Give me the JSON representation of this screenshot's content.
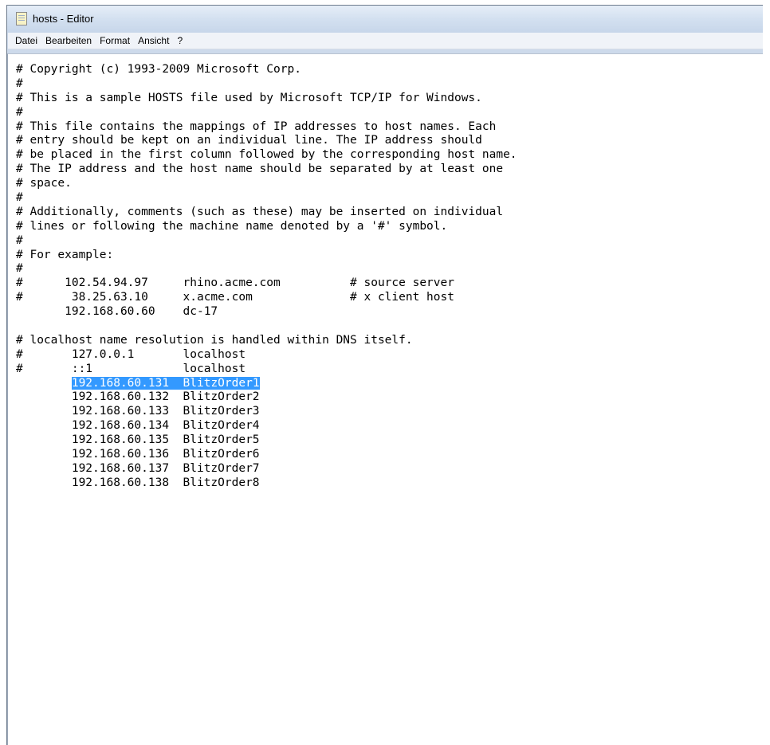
{
  "window": {
    "title": "hosts - Editor",
    "icon": "notepad-icon"
  },
  "menu": {
    "items": [
      "Datei",
      "Bearbeiten",
      "Format",
      "Ansicht",
      "?"
    ]
  },
  "editor": {
    "lines": [
      "# Copyright (c) 1993-2009 Microsoft Corp.",
      "#",
      "# This is a sample HOSTS file used by Microsoft TCP/IP for Windows.",
      "#",
      "# This file contains the mappings of IP addresses to host names. Each",
      "# entry should be kept on an individual line. The IP address should",
      "# be placed in the first column followed by the corresponding host name.",
      "# The IP address and the host name should be separated by at least one",
      "# space.",
      "#",
      "# Additionally, comments (such as these) may be inserted on individual",
      "# lines or following the machine name denoted by a '#' symbol.",
      "#",
      "# For example:",
      "#",
      "#      102.54.94.97     rhino.acme.com          # source server",
      "#       38.25.63.10     x.acme.com              # x client host",
      "       192.168.60.60    dc-17",
      "",
      "# localhost name resolution is handled within DNS itself.",
      "#       127.0.0.1       localhost",
      "#       ::1             localhost",
      "        192.168.60.131  BlitzOrder1",
      "        192.168.60.132  BlitzOrder2",
      "        192.168.60.133  BlitzOrder3",
      "        192.168.60.134  BlitzOrder4",
      "        192.168.60.135  BlitzOrder5",
      "        192.168.60.136  BlitzOrder6",
      "        192.168.60.137  BlitzOrder7",
      "        192.168.60.138  BlitzOrder8"
    ],
    "selection": {
      "line_index": 22,
      "prefix": "        ",
      "text": "192.168.60.131  BlitzOrder1"
    }
  },
  "colors": {
    "selection_bg": "#3399ff",
    "selection_fg": "#ffffff"
  }
}
